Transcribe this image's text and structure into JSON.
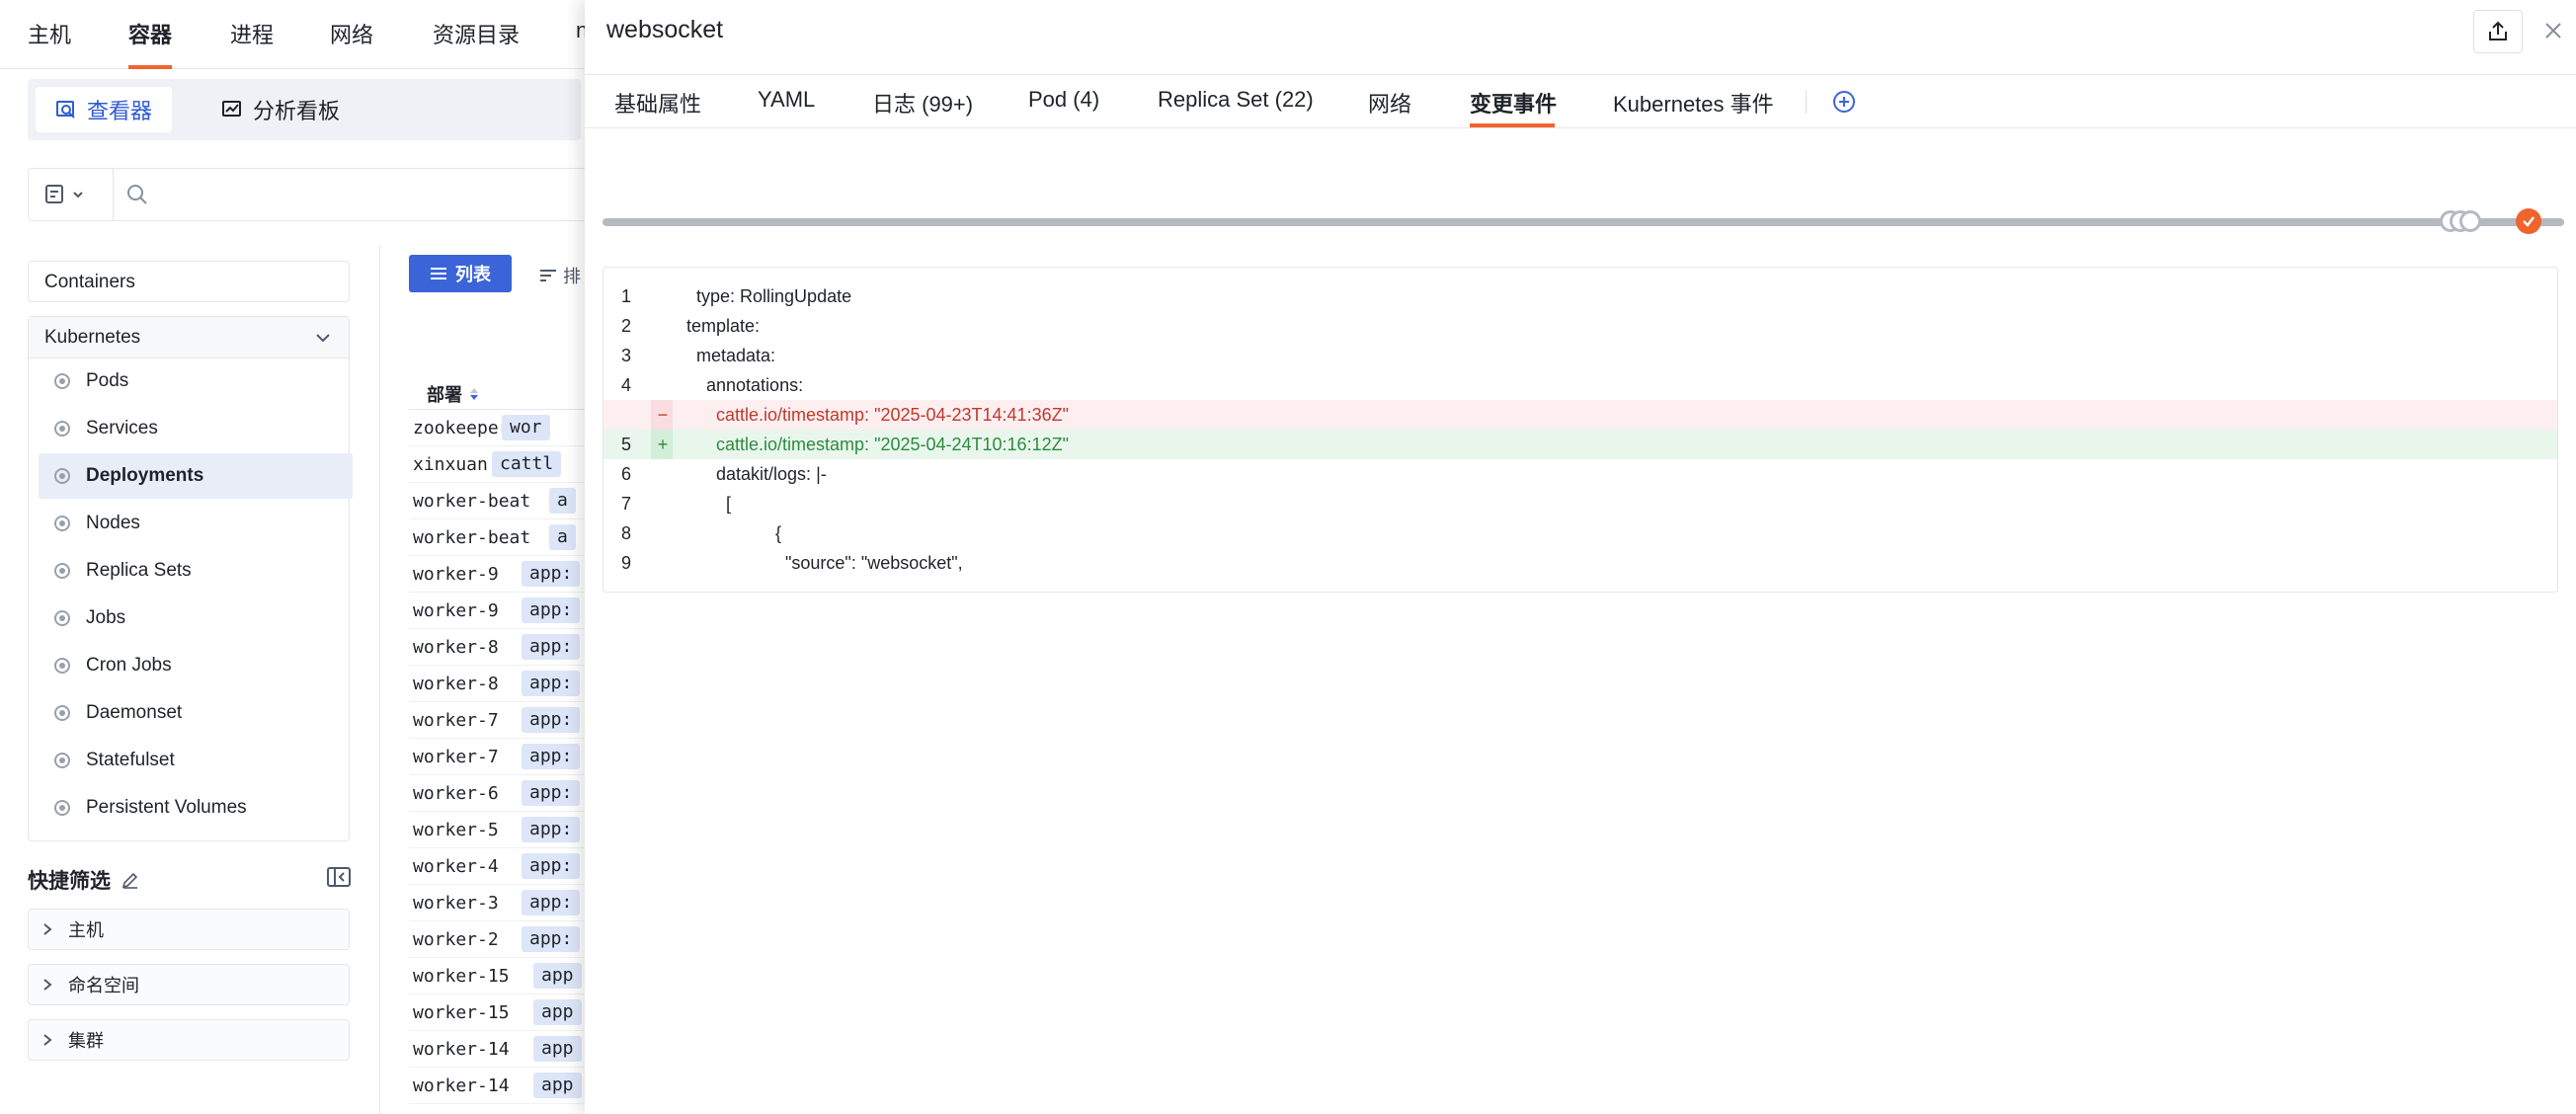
{
  "topnav": {
    "items": [
      "主机",
      "容器",
      "进程",
      "网络",
      "资源目录",
      "n"
    ],
    "active_index": 1
  },
  "view_tabs": {
    "viewer": "查看器",
    "dashboard": "分析看板"
  },
  "sidebar": {
    "containers_label": "Containers",
    "kubernetes_label": "Kubernetes",
    "items": [
      "Pods",
      "Services",
      "Deployments",
      "Nodes",
      "Replica Sets",
      "Jobs",
      "Cron Jobs",
      "Daemonset",
      "Statefulset",
      "Persistent Volumes"
    ],
    "active_index": 2,
    "quick_filter": {
      "title": "快捷筛选",
      "groups": [
        "主机",
        "命名空间",
        "集群"
      ]
    }
  },
  "list": {
    "list_button": "列表",
    "sort_label": "排",
    "column_header": "部署",
    "rows": [
      {
        "name": "zookeeper",
        "tag": "wor"
      },
      {
        "name": "xinxuan",
        "tag": "cattl"
      },
      {
        "name": "worker-beat",
        "tag": "a"
      },
      {
        "name": "worker-beat",
        "tag": "a"
      },
      {
        "name": "worker-9",
        "tag": "app:"
      },
      {
        "name": "worker-9",
        "tag": "app:"
      },
      {
        "name": "worker-8",
        "tag": "app:"
      },
      {
        "name": "worker-8",
        "tag": "app:"
      },
      {
        "name": "worker-7",
        "tag": "app:"
      },
      {
        "name": "worker-7",
        "tag": "app:"
      },
      {
        "name": "worker-6",
        "tag": "app:"
      },
      {
        "name": "worker-5",
        "tag": "app:"
      },
      {
        "name": "worker-4",
        "tag": "app:"
      },
      {
        "name": "worker-3",
        "tag": "app:"
      },
      {
        "name": "worker-2",
        "tag": "app:"
      },
      {
        "name": "worker-15",
        "tag": "app"
      },
      {
        "name": "worker-15",
        "tag": "app"
      },
      {
        "name": "worker-14",
        "tag": "app"
      },
      {
        "name": "worker-14",
        "tag": "app"
      }
    ]
  },
  "drawer": {
    "title": "websocket",
    "tabs": [
      "基础属性",
      "YAML",
      "日志 (99+)",
      "Pod (4)",
      "Replica Set (22)",
      "网络",
      "变更事件",
      "Kubernetes 事件"
    ],
    "active_tab_index": 6,
    "diff_lines": [
      {
        "num": "1",
        "marker": "",
        "type": "ctx",
        "text": "  type: RollingUpdate"
      },
      {
        "num": "2",
        "marker": "",
        "type": "ctx",
        "text": "template:"
      },
      {
        "num": "3",
        "marker": "",
        "type": "ctx",
        "text": "  metadata:"
      },
      {
        "num": "4",
        "marker": "",
        "type": "ctx",
        "text": "    annotations:"
      },
      {
        "num": "",
        "marker": "−",
        "type": "del",
        "text": "      cattle.io/timestamp: \"2025-04-23T14:41:36Z\""
      },
      {
        "num": "5",
        "marker": "+",
        "type": "add",
        "text": "      cattle.io/timestamp: \"2025-04-24T10:16:12Z\""
      },
      {
        "num": "6",
        "marker": "",
        "type": "ctx",
        "text": "      datakit/logs: |-"
      },
      {
        "num": "7",
        "marker": "",
        "type": "ctx",
        "text": "        ["
      },
      {
        "num": "8",
        "marker": "",
        "type": "ctx",
        "text": "                  {"
      },
      {
        "num": "9",
        "marker": "",
        "type": "ctx",
        "text": "                    \"source\": \"websocket\","
      }
    ]
  },
  "colors": {
    "accent": "#f0642d",
    "primary": "#3b64d8",
    "del_text": "#c0392b",
    "add_text": "#2e8b3e"
  }
}
